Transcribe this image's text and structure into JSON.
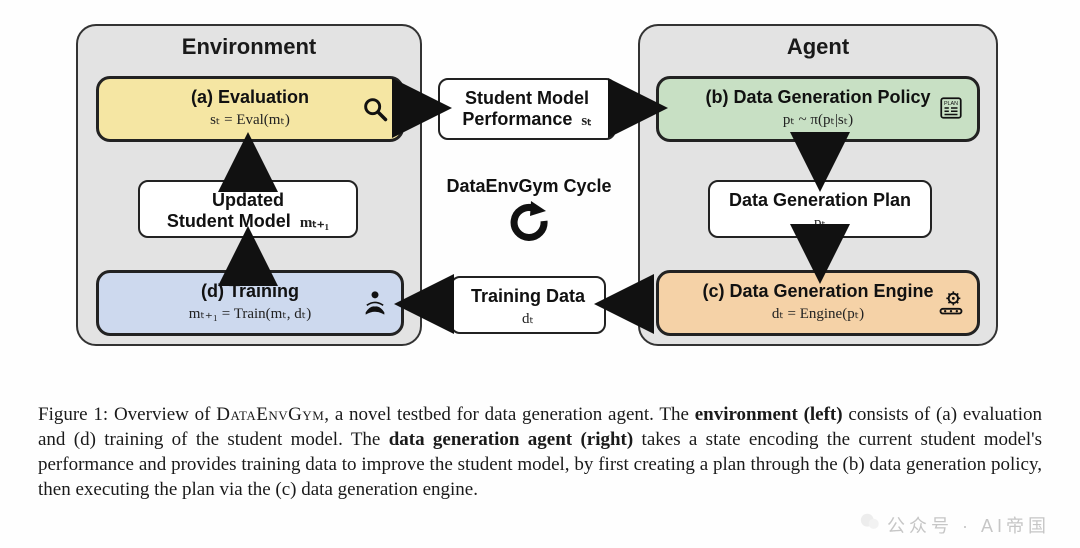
{
  "environment": {
    "title": "Environment",
    "eval": {
      "title": "(a) Evaluation",
      "sub": "sₜ = Eval(mₜ)",
      "icon": "magnify-icon"
    },
    "updated": {
      "title": "Updated",
      "title2": "Student Model",
      "sub": "mₜ₊₁"
    },
    "train": {
      "title": "(d) Training",
      "sub": "mₜ₊₁ = Train(mₜ, dₜ)",
      "icon": "reader-icon"
    }
  },
  "center": {
    "perf": {
      "title": "Student Model",
      "title2": "Performance",
      "sub": "sₜ"
    },
    "cycle": {
      "label": "DataEnvGym Cycle",
      "icon": "cycle-arrow-icon"
    },
    "tdata": {
      "title": "Training Data",
      "sub": "dₜ"
    }
  },
  "agent": {
    "title": "Agent",
    "policy": {
      "title": "(b) Data Generation Policy",
      "sub": "pₜ ~ π(pₜ|sₜ)",
      "icon": "plan-scroll-icon"
    },
    "plan": {
      "title": "Data Generation Plan",
      "sub": "pₜ"
    },
    "engine": {
      "title": "(c) Data Generation Engine",
      "sub": "dₜ = Engine(pₜ)",
      "icon": "gear-conveyor-icon"
    }
  },
  "caption": {
    "prefix": "Figure 1:  Overview of ",
    "name": "DataEnvGym",
    "mid1": ", a novel testbed for data generation agent. The ",
    "b1": "environment (left)",
    "mid2": " consists of (a) evaluation and (d) training of the student model. The ",
    "b2": "data generation agent (right)",
    "mid3": " takes a state encoding the current student model's performance and provides training data to improve the student model, by first creating a plan through the (b) data generation policy, then executing the plan via the (c) data generation engine."
  },
  "watermark": {
    "text": "公众号 · AI帝国",
    "icon": "wechat-icon"
  }
}
